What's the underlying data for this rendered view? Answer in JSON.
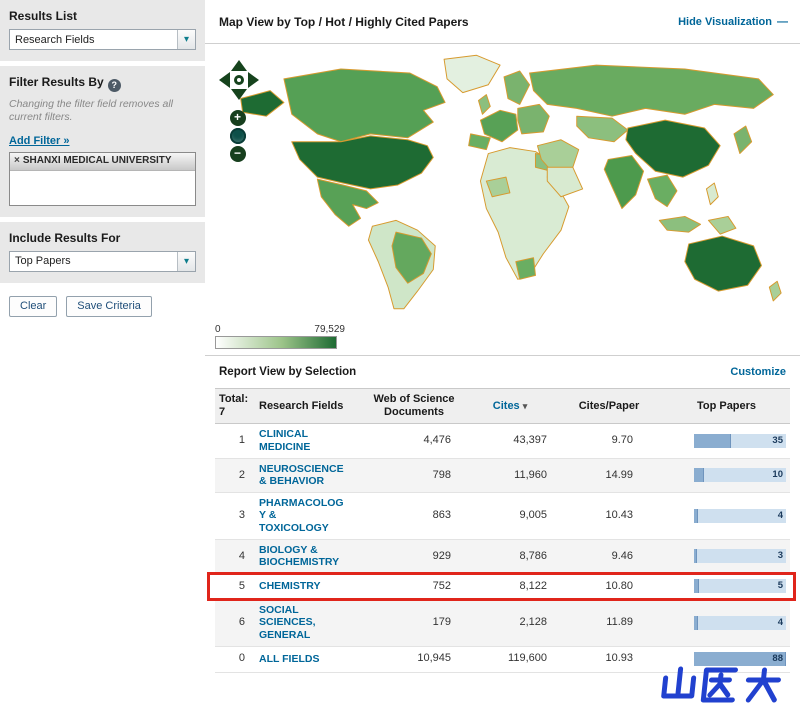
{
  "sidebar": {
    "results_list": {
      "label": "Results List",
      "dropdown_value": "Research Fields"
    },
    "filter": {
      "label": "Filter Results By",
      "note": "Changing the filter field removes all current filters.",
      "add_filter_label": "Add Filter »",
      "active_filter": "SHANXI MEDICAL UNIVERSITY"
    },
    "include": {
      "label": "Include Results For",
      "dropdown_value": "Top Papers"
    },
    "buttons": {
      "clear": "Clear",
      "save": "Save Criteria"
    }
  },
  "header": {
    "title": "Map View by Top / Hot / Highly Cited Papers",
    "hide_visualization": "Hide Visualization"
  },
  "map": {
    "legend_min": "0",
    "legend_max": "79,529"
  },
  "report": {
    "title": "Report View by Selection",
    "customize": "Customize"
  },
  "table": {
    "total_label": "Total:",
    "total_value": "7",
    "headers": {
      "fields": "Research Fields",
      "documents": "Web of Science Documents",
      "cites": "Cites",
      "sort_icon": "▾",
      "cites_per_paper": "Cites/Paper",
      "top_papers": "Top Papers"
    },
    "top_papers_max": 88,
    "rows": [
      {
        "rank": "1",
        "field": "CLINICAL MEDICINE",
        "documents": "4,476",
        "cites": "43,397",
        "cites_per_paper": "9.70",
        "top_papers": 35
      },
      {
        "rank": "2",
        "field": "NEUROSCIENCE & BEHAVIOR",
        "documents": "798",
        "cites": "11,960",
        "cites_per_paper": "14.99",
        "top_papers": 10
      },
      {
        "rank": "3",
        "field": "PHARMACOLOGY & TOXICOLOGY",
        "documents": "863",
        "cites": "9,005",
        "cites_per_paper": "10.43",
        "top_papers": 4
      },
      {
        "rank": "4",
        "field": "BIOLOGY & BIOCHEMISTRY",
        "documents": "929",
        "cites": "8,786",
        "cites_per_paper": "9.46",
        "top_papers": 3
      },
      {
        "rank": "5",
        "field": "CHEMISTRY",
        "documents": "752",
        "cites": "8,122",
        "cites_per_paper": "10.80",
        "top_papers": 5,
        "highlighted": true
      },
      {
        "rank": "6",
        "field": "SOCIAL SCIENCES, GENERAL",
        "documents": "179",
        "cites": "2,128",
        "cites_per_paper": "11.89",
        "top_papers": 4
      },
      {
        "rank": "0",
        "field": "ALL FIELDS",
        "documents": "10,945",
        "cites": "119,600",
        "cites_per_paper": "10.93",
        "top_papers": 88
      }
    ]
  },
  "icons": {
    "chevron_down": "▾",
    "help": "?",
    "remove": "×",
    "collapse": "—",
    "zoom_in": "+",
    "zoom_out": "−"
  },
  "watermark": {
    "text": "山医大"
  },
  "colors": {
    "link_teal": "#006699",
    "bar_fill": "#8aadd0",
    "bar_track": "#cfe0ef",
    "highlight_red": "#e0251b",
    "map_scale_max": "#1e6b33",
    "map_scale_min": "#ffffff",
    "map_border_orange": "#d79a2e",
    "watermark_blue": "#2141cf"
  }
}
